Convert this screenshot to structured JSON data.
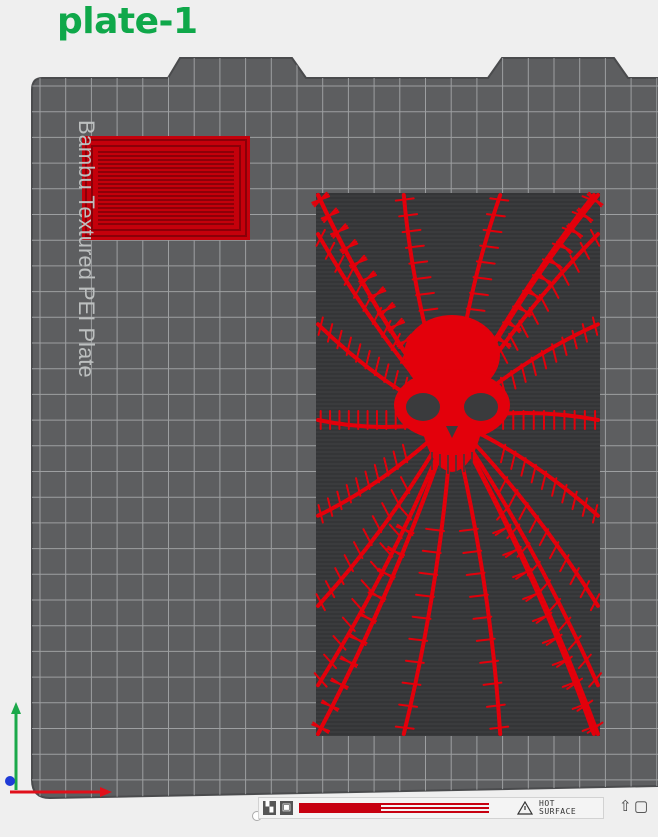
{
  "plate": {
    "title": "plate-1"
  },
  "bed": {
    "label": "Bambu Textured PEI Plate",
    "warning_text": "HOT\nSURFACE"
  },
  "objects": [
    {
      "name": "small-rectangular-block",
      "color": "#d9000d"
    },
    {
      "name": "skull-spiderweb-panel",
      "color": "#e3000b"
    }
  ],
  "axes": {
    "x_color": "#e0101a",
    "y_color": "#1ba84a",
    "z_color": "#1f3bd6"
  },
  "colors": {
    "background": "#efefef",
    "bed": "#5d5e60",
    "bed_border": "#4a4b4d",
    "grid": "#aeb0b2",
    "title": "#0fa84a",
    "filament": "#e3000b",
    "panel_base": "#3a3b3d"
  },
  "icons": {
    "bottom_left_badges": [
      "plate-type-icon",
      "qr-code-icon"
    ],
    "right_edge": [
      "upload-icon",
      "square-icon"
    ]
  }
}
